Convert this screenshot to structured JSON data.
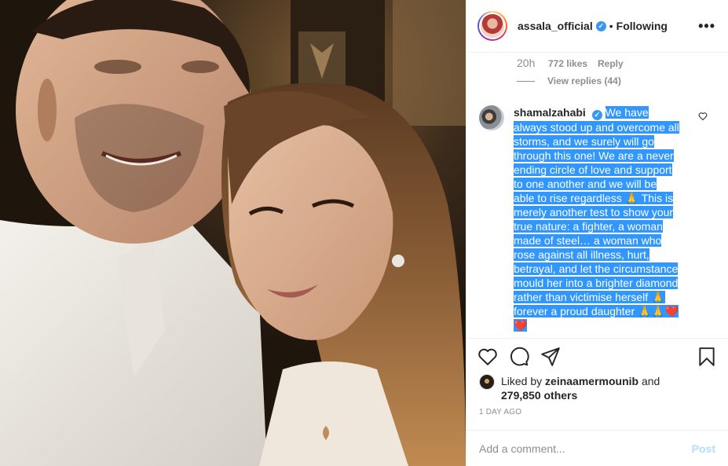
{
  "header": {
    "username": "assala_official",
    "separator": "•",
    "follow_status": "Following",
    "more": "•••"
  },
  "previous_comment": {
    "time": "20h",
    "likes": "772 likes",
    "reply": "Reply",
    "view_replies": "View replies (44)"
  },
  "comment": {
    "username": "shamalzahabi",
    "text": "We have always stood up and overcome all storms, and we surely will go through this one! We are a never ending circle of love and support to one another and we will be able to rise regardless 🙏 This is merely another test to show your true nature: a fighter, a woman made of steel… a woman who rose against all illness, hurt, betrayal, and let the circumstance mould her into a brighter diamond rather than victimise herself 🙏 forever a proud daughter 🙏🙏❤️❤️",
    "selection_color": "#3297fd"
  },
  "likes": {
    "prefix": "Liked by ",
    "liker": "zeinaamermounib",
    "and": " and",
    "others": "279,850 others"
  },
  "posted": "1 DAY AGO",
  "add_comment": {
    "placeholder": "Add a comment...",
    "post_label": "Post"
  },
  "icons": {
    "verified": "verified-badge-icon",
    "like": "heart-icon",
    "comment": "comment-bubble-icon",
    "share": "paper-plane-icon",
    "save": "bookmark-icon"
  },
  "colors": {
    "accent": "#3897f0",
    "muted": "#8e8e8e",
    "post_disabled": "#b2dffc"
  }
}
